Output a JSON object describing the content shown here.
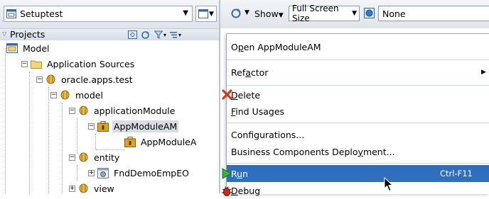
{
  "app_select": {
    "label": "Setuptest"
  },
  "projects": {
    "label": "Projects"
  },
  "tree": {
    "model": "Model",
    "app_sources": "Application Sources",
    "pkg_test": "oracle.apps.test",
    "pkg_model": "model",
    "pkg_appmodule": "applicationModule",
    "appmodule_am": "AppModuleAM",
    "appmodule_a": "AppModuleA",
    "pkg_entity": "entity",
    "fnd_demo": "FndDemoEmpEO",
    "pkg_view": "view"
  },
  "toolbar": {
    "show_label": "Show",
    "size_select": "Full Screen Size",
    "none_field": "None"
  },
  "context_menu": {
    "open_pre": "O",
    "open_u": "p",
    "open_post": "en AppModuleAM",
    "refactor_pre": "Ref",
    "refactor_u": "a",
    "refactor_post": "ctor",
    "delete_u": "D",
    "delete_post": "elete",
    "find_u": "F",
    "find_post": "ind Usages",
    "config_pre": "Confi",
    "config_u": "g",
    "config_post": "urations...",
    "bc_pre": "Business Components Deplo",
    "bc_u": "y",
    "bc_post": "ment...",
    "run_pre": "R",
    "run_u": "u",
    "run_post": "n",
    "run_shortcut": "Ctrl-F11",
    "debug_u": "D",
    "debug_post": "ebug"
  },
  "colors": {
    "highlight": "#2f6fbd",
    "package": "#b8860b"
  }
}
